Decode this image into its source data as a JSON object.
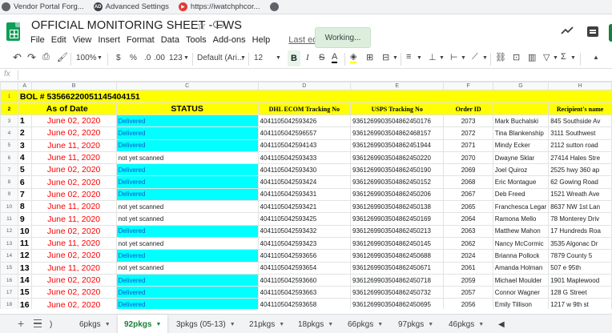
{
  "bookmarks": [
    {
      "label": "Vendor Portal Forg...",
      "icon": "globe-icon",
      "color": "#5f6368"
    },
    {
      "label": "Advanced Settings",
      "icon": "ad-icon",
      "color": "#3c4043"
    },
    {
      "label": "https://iwatchphcor...",
      "icon": "play-icon",
      "color": "#e53935"
    },
    {
      "label": "",
      "icon": "globe-icon",
      "color": "#5f6368"
    }
  ],
  "header": {
    "title": "OFFICIAL MONITORING SHEET - FWS",
    "menus": [
      "File",
      "Edit",
      "View",
      "Insert",
      "Format",
      "Data",
      "Tools",
      "Add-ons",
      "Help"
    ],
    "last_edit": "Last edit was yeste",
    "working": "Working..."
  },
  "toolbar": {
    "zoom": "100%",
    "currency": "$",
    "percent": "%",
    "dec_less": ".0",
    "dec_more": ".00",
    "format_more": "123",
    "font": "Default (Ari...",
    "font_size": "12",
    "bold": "B",
    "italic": "I",
    "strike": "S",
    "text_color": "A",
    "sum": "Σ"
  },
  "formula": {
    "fx": "fx"
  },
  "columns": [
    "A",
    "B",
    "C",
    "D",
    "E",
    "F",
    "G",
    "H"
  ],
  "bol": "BOL #  5356622005114540415​1",
  "headers": {
    "as_of": "As of Date",
    "status": "STATUS",
    "dhl": "DHL ECOM Tracking No",
    "usps": "USPS Tracking No",
    "order": "Order ID",
    "name": "",
    "recipient": "Recipient's name"
  },
  "rows": [
    {
      "row": "3",
      "n": "1",
      "date": "June 02, 2020",
      "status": "Delivered",
      "delivered": true,
      "dhl": "4041105042593426",
      "usps": "9361269903504862450176",
      "order": "2073",
      "name": "Mark Buchalski",
      "addr": "845 Southside Av"
    },
    {
      "row": "4",
      "n": "2",
      "date": "June 02, 2020",
      "status": "Delivered",
      "delivered": true,
      "dhl": "4041105042596557",
      "usps": "9361269903504862468157",
      "order": "2072",
      "name": "Tina Blankenship",
      "addr": "3111 Southwest"
    },
    {
      "row": "5",
      "n": "3",
      "date": "June 11, 2020",
      "status": "Delivered",
      "delivered": true,
      "dhl": "4041105042594143",
      "usps": "9361269903504862451944",
      "order": "2071",
      "name": "Mindy Ecker",
      "addr": "2112 sutton road"
    },
    {
      "row": "6",
      "n": "4",
      "date": "June 11, 2020",
      "status": "not yet scanned",
      "delivered": false,
      "dhl": "4041105042593433",
      "usps": "9361269903504862450220",
      "order": "2070",
      "name": "Dwayne Sklar",
      "addr": "27414 Hales Stre"
    },
    {
      "row": "7",
      "n": "5",
      "date": "June 02, 2020",
      "status": "Delivered",
      "delivered": true,
      "dhl": "4041105042593430",
      "usps": "9361269903504862450190",
      "order": "2069",
      "name": "Joel Quiroz",
      "addr": "2525 hwy 360 ap"
    },
    {
      "row": "8",
      "n": "6",
      "date": "June 02, 2020",
      "status": "Delivered",
      "delivered": true,
      "dhl": "4041105042593424",
      "usps": "9361269903504862450152",
      "order": "2068",
      "name": "Eric Montague",
      "addr": "62 Gowing Road"
    },
    {
      "row": "9",
      "n": "7",
      "date": "June 02, 2020",
      "status": "Delivered",
      "delivered": true,
      "dhl": "4041105042593431",
      "usps": "9361269903504862450206",
      "order": "2067",
      "name": "Deb Freed",
      "addr": "1521 Wreath Ave"
    },
    {
      "row": "10",
      "n": "8",
      "date": "June 11, 2020",
      "status": "not yet scanned",
      "delivered": false,
      "dhl": "4041105042593421",
      "usps": "9361269903504862450138",
      "order": "2065",
      "name": "Franchesca Legar",
      "addr": "8637 NW 1st Lan"
    },
    {
      "row": "11",
      "n": "9",
      "date": "June 11, 2020",
      "status": "not yet scanned",
      "delivered": false,
      "dhl": "4041105042593425",
      "usps": "9361269903504862450169",
      "order": "2064",
      "name": "Ramona Mello",
      "addr": "78 Monterey Driv"
    },
    {
      "row": "12",
      "n": "10",
      "date": "June 02, 2020",
      "status": "Delivered",
      "delivered": true,
      "dhl": "4041105042593432",
      "usps": "9361269903504862450213",
      "order": "2063",
      "name": "Matthew Mahon",
      "addr": "17 Hundreds Roa"
    },
    {
      "row": "13",
      "n": "11",
      "date": "June 11, 2020",
      "status": "not yet scanned",
      "delivered": false,
      "dhl": "4041105042593423",
      "usps": "9361269903504862450145",
      "order": "2062",
      "name": "Nancy McCormic",
      "addr": "3535 Algonac Dr"
    },
    {
      "row": "14",
      "n": "12",
      "date": "June 02, 2020",
      "status": "Delivered",
      "delivered": true,
      "dhl": "4041105042593656",
      "usps": "9361269903504862450688",
      "order": "2024",
      "name": "Brianna Pollock",
      "addr": "7879 County 5"
    },
    {
      "row": "15",
      "n": "13",
      "date": "June 11, 2020",
      "status": "not yet scanned",
      "delivered": false,
      "dhl": "4041105042593654",
      "usps": "9361269903504862450671",
      "order": "2061",
      "name": "Amanda Holman",
      "addr": "507 e 95th"
    },
    {
      "row": "16",
      "n": "14",
      "date": "June 02, 2020",
      "status": "Delivered",
      "delivered": true,
      "dhl": "4041105042593660",
      "usps": "9361269903504862450718",
      "order": "2059",
      "name": "Michael Moulder",
      "addr": "1901 Maplewood"
    },
    {
      "row": "17",
      "n": "15",
      "date": "June 02, 2020",
      "status": "Delivered",
      "delivered": true,
      "dhl": "4041105042593663",
      "usps": "9361269903504862450732",
      "order": "2057",
      "name": "Connor Wagner",
      "addr": "128 G Street"
    },
    {
      "row": "18",
      "n": "16",
      "date": "June 02, 2020",
      "status": "Delivered",
      "delivered": true,
      "dhl": "4041105042593658",
      "usps": "9361269903504862450695",
      "order": "2056",
      "name": "Emily Tillison",
      "addr": "1217 w 9th st"
    }
  ],
  "tabs": [
    {
      "label": ")",
      "active": false
    },
    {
      "label": "6pkgs",
      "active": false
    },
    {
      "label": "92pkgs",
      "active": true
    },
    {
      "label": "3pkgs (05-13)",
      "active": false
    },
    {
      "label": "21pkgs",
      "active": false
    },
    {
      "label": "18pkgs",
      "active": false
    },
    {
      "label": "66pkgs",
      "active": false
    },
    {
      "label": "97pkgs",
      "active": false
    },
    {
      "label": "46pkgs",
      "active": false
    }
  ],
  "colors": {
    "accent": "#188038",
    "yellow": "#ffff00",
    "cyan": "#00ffff",
    "date_red": "#ff0000"
  }
}
